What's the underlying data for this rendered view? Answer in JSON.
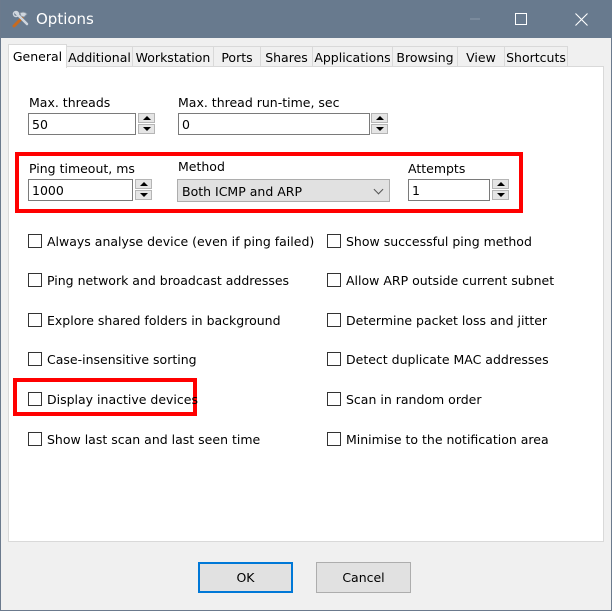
{
  "window": {
    "title": "Options",
    "app_icon": "tools-icon",
    "controls": {
      "minimize": "minimize-icon",
      "maximize": "maximize-icon",
      "close": "close-icon"
    }
  },
  "tabs": [
    {
      "label": "General",
      "active": true
    },
    {
      "label": "Additional",
      "active": false
    },
    {
      "label": "Workstation",
      "active": false
    },
    {
      "label": "Ports",
      "active": false
    },
    {
      "label": "Shares",
      "active": false
    },
    {
      "label": "Applications",
      "active": false
    },
    {
      "label": "Browsing",
      "active": false
    },
    {
      "label": "View",
      "active": false
    },
    {
      "label": "Shortcuts",
      "active": false
    }
  ],
  "general": {
    "max_threads": {
      "label": "Max. threads",
      "value": "50"
    },
    "max_thread_runtime": {
      "label": "Max. thread run-time, sec",
      "value": "0"
    },
    "ping_timeout": {
      "label": "Ping timeout, ms",
      "value": "1000"
    },
    "method": {
      "label": "Method",
      "value": "Both ICMP and ARP"
    },
    "attempts": {
      "label": "Attempts",
      "value": "1"
    },
    "left_options": [
      {
        "label": "Always analyse device (even if ping failed)",
        "checked": false
      },
      {
        "label": "Ping network and broadcast addresses",
        "checked": false
      },
      {
        "label": "Explore shared folders in background",
        "checked": false
      },
      {
        "label": "Case-insensitive sorting",
        "checked": false
      },
      {
        "label": "Display inactive devices",
        "checked": false
      },
      {
        "label": "Show last scan and last seen time",
        "checked": false
      }
    ],
    "right_options": [
      {
        "label": "Show successful ping method",
        "checked": false
      },
      {
        "label": "Allow ARP outside current subnet",
        "checked": false
      },
      {
        "label": "Determine packet loss and jitter",
        "checked": false
      },
      {
        "label": "Detect duplicate MAC addresses",
        "checked": false
      },
      {
        "label": "Scan in random order",
        "checked": false
      },
      {
        "label": "Minimise to the notification area",
        "checked": false
      }
    ]
  },
  "buttons": {
    "ok": "OK",
    "cancel": "Cancel"
  },
  "highlight_color": "#ff0000",
  "accent_color": "#0078d7"
}
